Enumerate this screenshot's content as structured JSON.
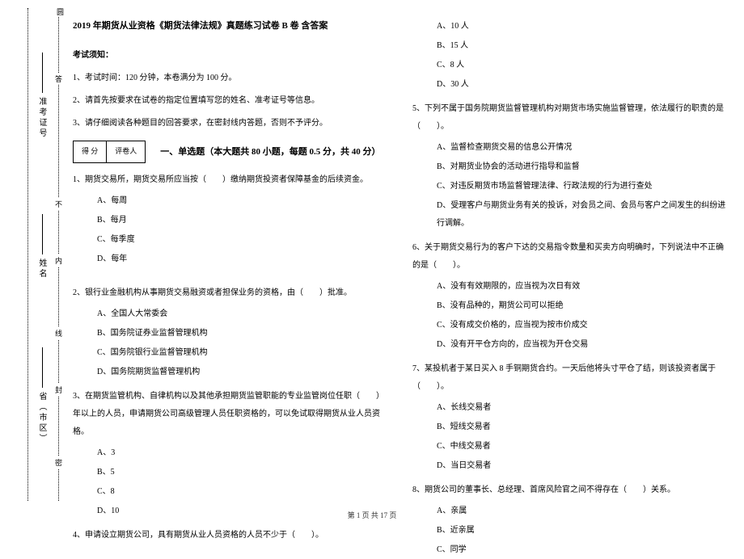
{
  "header": {
    "title": "2019 年期货从业资格《期货法律法规》真题练习试卷 B 卷 含答案"
  },
  "instructions": {
    "heading": "考试须知：",
    "items": [
      "1、考试时间：120 分钟，本卷满分为 100 分。",
      "2、请首先按要求在试卷的指定位置填写您的姓名、准考证号等信息。",
      "3、请仔细阅读各种题目的回答要求，在密封线内答题，否则不予评分。"
    ]
  },
  "score_box": {
    "cells": [
      "得 分",
      "评卷人"
    ]
  },
  "part1": {
    "heading": "一、单选题（本大题共 80 小题，每题 0.5 分，共 40 分）"
  },
  "questions": {
    "q1": {
      "stem": "1、期货交易所，期货交易所应当按（　　）缴纳期货投资者保障基金的后续资金。",
      "opts": [
        "A、每周",
        "B、每月",
        "C、每季度",
        "D、每年"
      ]
    },
    "q2": {
      "stem": "2、银行业金融机构从事期货交易融资或者担保业务的资格，由（　　）批准。",
      "opts": [
        "A、全国人大常委会",
        "B、国务院证券业监督管理机构",
        "C、国务院银行业监督管理机构",
        "D、国务院期货监督管理机构"
      ]
    },
    "q3": {
      "stem": "3、在期货监管机构、自律机构以及其他承担期货监管职能的专业监管岗位任职（　　）年以上的人员，申请期货公司高级管理人员任职资格的，可以免试取得期货从业人员资格。",
      "opts": [
        "A、3",
        "B、5",
        "C、8",
        "D、10"
      ]
    },
    "q4": {
      "stem": "4、申请设立期货公司，具有期货从业人员资格的人员不少于（　　）。",
      "opts": [
        "A、10 人",
        "B、15 人",
        "C、8 人",
        "D、30 人"
      ]
    },
    "q5": {
      "stem": "5、下列不属于国务院期货监督管理机构对期货市场实施监督管理，依法履行的职责的是（　　）。",
      "opts": [
        "A、监督检查期货交易的信息公开情况",
        "B、对期货业协会的活动进行指导和监督",
        "C、对违反期货市场监督管理法律、行政法规的行为进行查处",
        "D、受理客户与期货业务有关的投诉，对会员之间、会员与客户之间发生的纠纷进行调解。"
      ]
    },
    "q6": {
      "stem": "6、关于期货交易行为的客户下达的交易指令数量和买卖方向明确时，下列说法中不正确的是（　　）。",
      "opts": [
        "A、没有有效期限的，应当视为次日有效",
        "B、没有品种的，期货公司可以拒绝",
        "C、没有成交价格的，应当视为按市价成交",
        "D、没有开平仓方向的，应当视为开仓交易"
      ]
    },
    "q7": {
      "stem": "7、某投机者于某日买入 8 手铜期货合约。一天后他将头寸平仓了结，则该投资者属于（　　）。",
      "opts": [
        "A、长线交易者",
        "B、短线交易者",
        "C、中线交易者",
        "D、当日交易者"
      ]
    },
    "q8": {
      "stem": "8、期货公司的董事长、总经理、首席风险官之间不得存在（　　）关系。",
      "opts": [
        "A、亲属",
        "B、近亲属",
        "C、同学"
      ]
    }
  },
  "gutter": {
    "top_char": "圆",
    "fields": [
      "准考证号",
      "姓名",
      "省（市区）"
    ],
    "between": [
      "答",
      "不",
      "内",
      "线",
      "封",
      "密"
    ]
  },
  "footer": "第 1 页 共 17 页"
}
